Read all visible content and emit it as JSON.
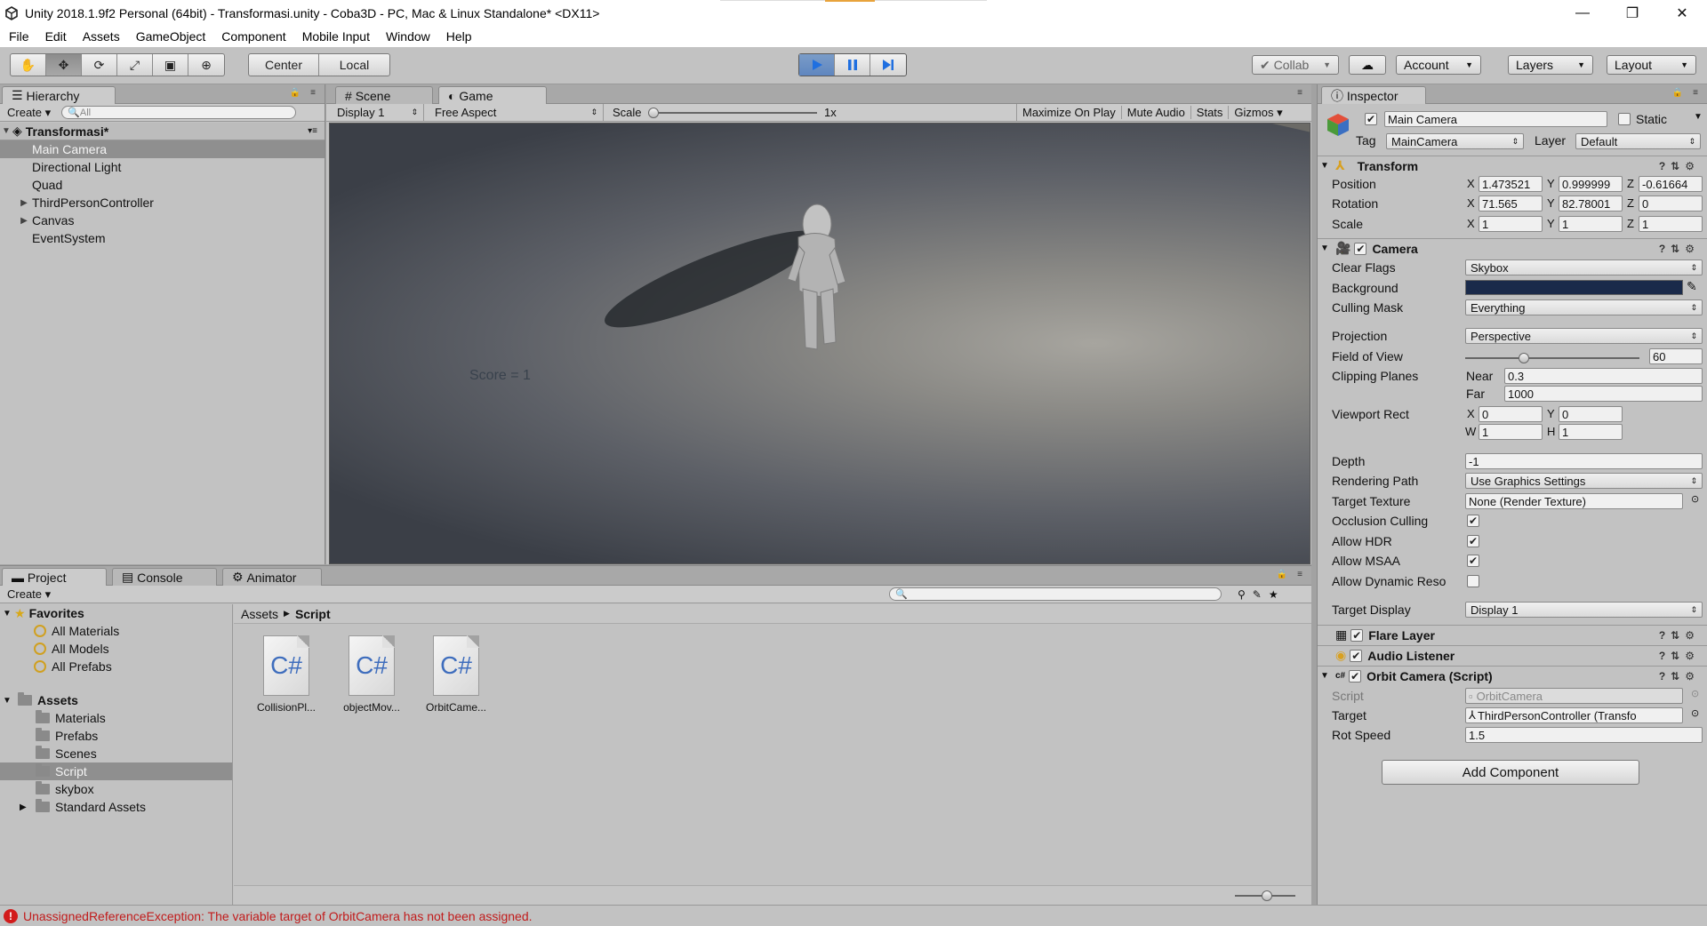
{
  "window": {
    "title": "Unity 2018.1.9f2 Personal (64bit) - Transformasi.unity - Coba3D - PC, Mac & Linux Standalone* <DX11>",
    "controls": [
      "—",
      "❐",
      "✕"
    ]
  },
  "menu": [
    "File",
    "Edit",
    "Assets",
    "GameObject",
    "Component",
    "Mobile Input",
    "Window",
    "Help"
  ],
  "toolbar": {
    "pivot": "Center",
    "space": "Local",
    "collab": "Collab",
    "account": "Account",
    "layers": "Layers",
    "layout": "Layout"
  },
  "hierarchy": {
    "tab": "Hierarchy",
    "create": "Create",
    "search_placeholder": "All",
    "scene": "Transformasi*",
    "items": [
      {
        "label": "Main Camera",
        "selected": true,
        "expandable": false
      },
      {
        "label": "Directional Light",
        "expandable": false
      },
      {
        "label": "Quad",
        "expandable": false
      },
      {
        "label": "ThirdPersonController",
        "expandable": true
      },
      {
        "label": "Canvas",
        "expandable": true
      },
      {
        "label": "EventSystem",
        "expandable": false
      }
    ]
  },
  "game": {
    "tabs": [
      "Scene",
      "Game"
    ],
    "display": "Display 1",
    "aspect": "Free Aspect",
    "scale_label": "Scale",
    "scale_value": "1x",
    "options": [
      "Maximize On Play",
      "Mute Audio",
      "Stats",
      "Gizmos"
    ],
    "score": "Score = 1"
  },
  "project": {
    "tabs": [
      "Project",
      "Console",
      "Animator"
    ],
    "create": "Create",
    "favorites_label": "Favorites",
    "favorites": [
      "All Materials",
      "All Models",
      "All Prefabs"
    ],
    "assets_label": "Assets",
    "folders": [
      {
        "label": "Materials"
      },
      {
        "label": "Prefabs"
      },
      {
        "label": "Scenes"
      },
      {
        "label": "Script",
        "selected": true
      },
      {
        "label": "skybox"
      },
      {
        "label": "Standard Assets",
        "expandable": true
      }
    ],
    "breadcrumb": [
      "Assets",
      "Script"
    ],
    "files": [
      {
        "icon": "C#",
        "name": "CollisionPl..."
      },
      {
        "icon": "C#",
        "name": "objectMov..."
      },
      {
        "icon": "C#",
        "name": "OrbitCame..."
      }
    ]
  },
  "inspector": {
    "tab": "Inspector",
    "object_name": "Main Camera",
    "static_label": "Static",
    "tag_label": "Tag",
    "tag": "MainCamera",
    "layer_label": "Layer",
    "layer": "Default",
    "transform": {
      "title": "Transform",
      "position_label": "Position",
      "position": {
        "x": "1.473521",
        "y": "0.999999",
        "z": "-0.61664"
      },
      "rotation_label": "Rotation",
      "rotation": {
        "x": "71.565",
        "y": "82.78001",
        "z": "0"
      },
      "scale_label": "Scale",
      "scale": {
        "x": "1",
        "y": "1",
        "z": "1"
      }
    },
    "camera": {
      "title": "Camera",
      "clear_flags_label": "Clear Flags",
      "clear_flags": "Skybox",
      "background_label": "Background",
      "background_color": "#1a2a4a",
      "culling_mask_label": "Culling Mask",
      "culling_mask": "Everything",
      "projection_label": "Projection",
      "projection": "Perspective",
      "fov_label": "Field of View",
      "fov": "60",
      "fov_fraction": 0.33,
      "clipping_label": "Clipping Planes",
      "near_label": "Near",
      "near": "0.3",
      "far_label": "Far",
      "far": "1000",
      "viewport_label": "Viewport Rect",
      "vx": "0",
      "vy": "0",
      "vw": "1",
      "vh": "1",
      "depth_label": "Depth",
      "depth": "-1",
      "rendering_path_label": "Rendering Path",
      "rendering_path": "Use Graphics Settings",
      "target_texture_label": "Target Texture",
      "target_texture": "None (Render Texture)",
      "occlusion_label": "Occlusion Culling",
      "hdr_label": "Allow HDR",
      "msaa_label": "Allow MSAA",
      "dynres_label": "Allow Dynamic Reso",
      "target_display_label": "Target Display",
      "target_display": "Display 1"
    },
    "flare_layer": "Flare Layer",
    "audio_listener": "Audio Listener",
    "orbit": {
      "title": "Orbit Camera (Script)",
      "script_label": "Script",
      "script": "OrbitCamera",
      "target_label": "Target",
      "target": "ThirdPersonController (Transfo",
      "rot_speed_label": "Rot Speed",
      "rot_speed": "1.5"
    },
    "add_component": "Add Component"
  },
  "console": {
    "error": "UnassignedReferenceException: The variable target of OrbitCamera has not been assigned."
  },
  "colors": {
    "accent_play": "#3d7ee0",
    "error": "#c11b1b"
  }
}
